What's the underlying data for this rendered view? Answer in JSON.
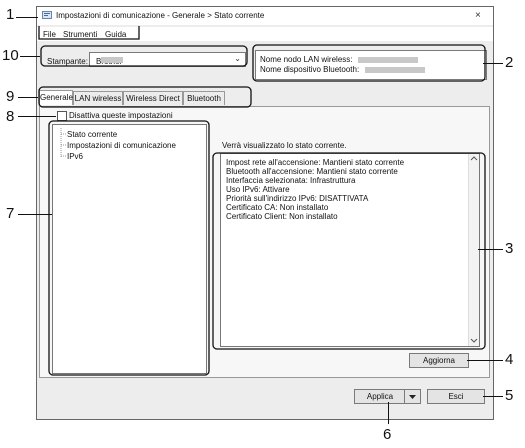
{
  "window": {
    "title": "Impostazioni di comunicazione - Generale > Stato corrente",
    "close_glyph": "×"
  },
  "menu": [
    "File",
    "Strumenti",
    "Guida"
  ],
  "printer": {
    "label": "Stampante:",
    "value": "Brother"
  },
  "info": {
    "lan_node_label": "Nome nodo LAN wireless:",
    "bluetooth_label": "Nome dispositivo Bluetooth:"
  },
  "tabs": [
    "Generale",
    "LAN wireless",
    "Wireless Direct",
    "Bluetooth"
  ],
  "disable_checkbox": "Disattiva queste impostazioni",
  "tree": [
    "Stato corrente",
    "Impostazioni di comunicazione",
    "IPv6"
  ],
  "status": {
    "label": "Verrà visualizzato lo stato corrente.",
    "lines": [
      "Impost rete all'accensione: Mantieni stato corrente",
      "Bluetooth all'accensione: Mantieni stato corrente",
      "Interfaccia selezionata: Infrastruttura",
      "Uso IPv6: Attivare",
      "Priorità sull'indirizzo IPv6: DISATTIVATA",
      "Certificato CA: Non installato",
      "Certificato Client: Non installato"
    ]
  },
  "buttons": {
    "refresh": "Aggiorna",
    "apply": "Applica",
    "exit": "Esci"
  },
  "callouts": [
    "1",
    "2",
    "3",
    "4",
    "5",
    "6",
    "7",
    "8",
    "9",
    "10"
  ]
}
